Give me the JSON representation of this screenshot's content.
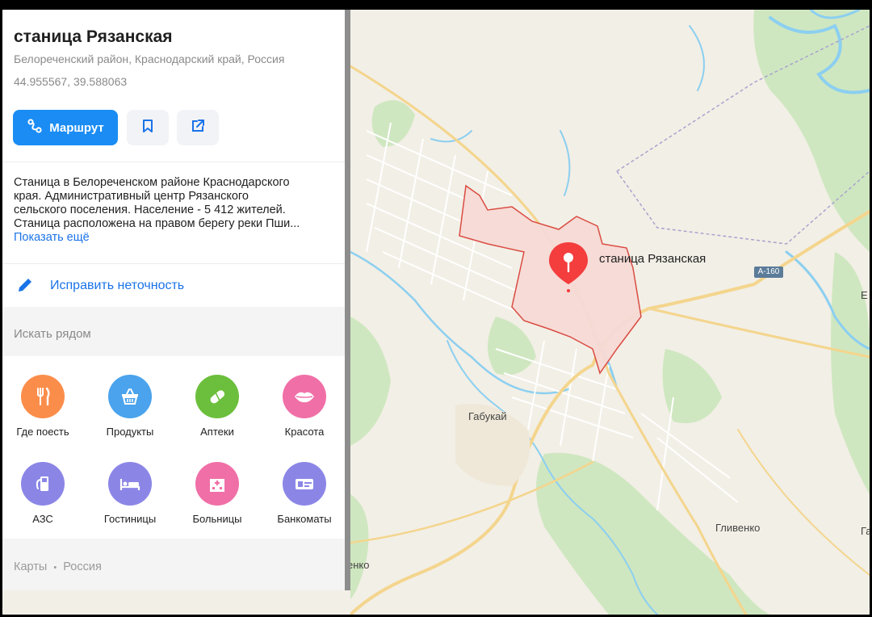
{
  "place": {
    "title": "станица Рязанская",
    "subtitle": "Белореченский район, Краснодарский край, Россия",
    "coords": "44.955567, 39.588063"
  },
  "actions": {
    "route_label": "Маршрут",
    "route_icon": "route-icon",
    "bookmark_icon": "bookmark-icon",
    "share_icon": "share-icon"
  },
  "description": {
    "lines": [
      "Станица в Белореченском районе Краснодарского",
      "края. Административный центр Рязанского",
      "сельского поселения. Население - 5 412 жителей.",
      "Станица расположена на правом берегу реки Пши..."
    ],
    "show_more": "Показать ещё"
  },
  "fix": {
    "label": "Исправить неточность",
    "icon": "pencil-icon"
  },
  "nearby": {
    "label": "Искать рядом",
    "categories": [
      {
        "label": "Где поесть",
        "icon": "fork-knife-icon",
        "color": "#fb8d4b"
      },
      {
        "label": "Продукты",
        "icon": "basket-icon",
        "color": "#4aa3ec"
      },
      {
        "label": "Аптеки",
        "icon": "pill-icon",
        "color": "#6cbf3c"
      },
      {
        "label": "Красота",
        "icon": "lips-icon",
        "color": "#f06fa7"
      },
      {
        "label": "АЗС",
        "icon": "fuel-icon",
        "color": "#8b86e6"
      },
      {
        "label": "Гостиницы",
        "icon": "bed-icon",
        "color": "#8b86e6"
      },
      {
        "label": "Больницы",
        "icon": "hospital-icon",
        "color": "#f06fa7"
      },
      {
        "label": "Банкоматы",
        "icon": "atm-icon",
        "color": "#8b86e6"
      }
    ]
  },
  "footer": {
    "maps_label": "Карты",
    "separator": "•",
    "country": "Россия"
  },
  "map": {
    "marker_label": "станица Рязанская",
    "places": [
      "Габукай",
      "Гливенко",
      "енко",
      "Е",
      "Га"
    ],
    "road_shield": "A-160",
    "colors": {
      "land": "#f2efe6",
      "forest": "#cfe7c0",
      "water": "#8ccff0",
      "area_fill": "#f7dad6",
      "area_border": "#d9443a",
      "marker": "#f43d3d"
    }
  }
}
